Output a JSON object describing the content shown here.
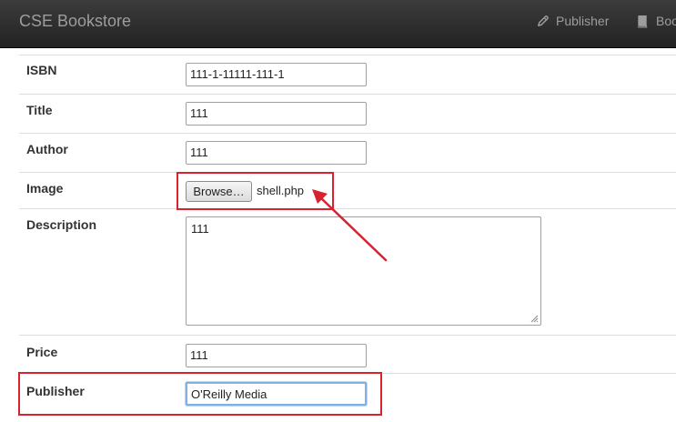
{
  "navbar": {
    "brand": "CSE Bookstore",
    "links": [
      {
        "label": "Publisher",
        "icon": "pencil-icon"
      },
      {
        "label": "Books",
        "icon": "book-icon"
      }
    ]
  },
  "form": {
    "isbn": {
      "label": "ISBN",
      "value": "111-1-11111-111-1"
    },
    "title": {
      "label": "Title",
      "value": "111"
    },
    "author": {
      "label": "Author",
      "value": "111"
    },
    "image": {
      "label": "Image",
      "button_label": "Browse…",
      "file_name": "shell.php"
    },
    "description": {
      "label": "Description",
      "value": "111"
    },
    "price": {
      "label": "Price",
      "value": "111"
    },
    "publisher": {
      "label": "Publisher",
      "value": "O'Reilly Media"
    }
  },
  "annotation_color": "#d9222f"
}
